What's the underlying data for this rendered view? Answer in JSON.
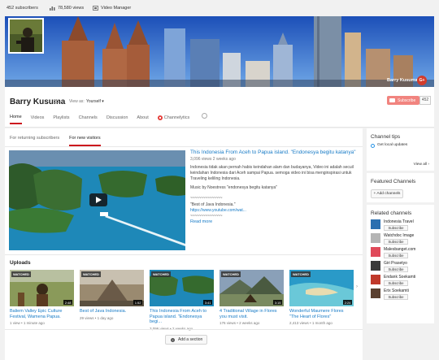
{
  "topbar": {
    "subscribers": "452 subscribers",
    "views": "78,580 views",
    "video_manager": "Video Manager"
  },
  "channel": {
    "name": "Barry Kusuma",
    "banner_name": "Barry Kusuma",
    "view_as_label": "View as:",
    "view_as_value": "Yourself",
    "subscribe_label": "Subscribe",
    "subscriber_count": "452",
    "gplus": "G+"
  },
  "tabs": [
    "Home",
    "Videos",
    "Playlists",
    "Channels",
    "Discussion",
    "About",
    "Channelytics"
  ],
  "subtabs": [
    "For returning subscribers",
    "For new visitors"
  ],
  "featured": {
    "title": "This Indonesia From Aceh to Papua island. \"Endonesya begitu katanya\"",
    "meta": "3,096 views  2 weeks ago",
    "description": "Indonesia tidak akan pernah habis keindahan alam dan budayanya, Video ini adalah secuil keindahan Indonesia dari Aceh sampai Papua. semoga video ini bisa menginspirasi untuk Traveling keliling Indonesia.",
    "music": "Music by Noestress \"endonesya begitu katanya\"",
    "dashes": "~~~~~~~~~~~~~~~",
    "best": "\"Best of Java Indonesia.\"",
    "link": "https://www.youtube.com/wat...",
    "dashes2": "~~~~~~~~~~~~~~~",
    "read_more": "Read more"
  },
  "uploads": {
    "title": "Uploads",
    "watched_label": "WATCHED",
    "items": [
      {
        "title": "Baliem Valley Epic Culture Festival, Wamena Papua.",
        "meta": "1 view  •  1 minute ago",
        "duration": "2:48"
      },
      {
        "title": "Best of Java Indonesia.",
        "meta": "29 views  •  1 day ago",
        "duration": "1:52"
      },
      {
        "title": "This Indonesia From Aceh to Papua island. \"Endonesya begi...",
        "meta": "3,096 views  •  2 weeks ago",
        "duration": "3:41"
      },
      {
        "title": "4 Traditional Village in Flores you must visit.",
        "meta": "176 views  •  2 weeks ago",
        "duration": "3:15"
      },
      {
        "title": "Wonderful Maumere Flores \"The Heart of Flores\"",
        "meta": "2,413 views  •  1 month ago",
        "duration": "2:24"
      }
    ],
    "next": "›"
  },
  "add_section": "Add a section",
  "sidebar": {
    "tips_title": "Channel tips",
    "tip_text": "Get local updates",
    "view_all": "View all ›",
    "featured_title": "Featured Channels",
    "add_channels": "+ Add channels",
    "related_title": "Related channels",
    "subscribe_label": "Subscribe",
    "related": [
      {
        "name": "Indonesia Travel",
        "color": "#2a6fb0"
      },
      {
        "name": "Watchdoc Image",
        "color": "#b5b5b5"
      },
      {
        "name": "Malesbanget.com",
        "color": "#e04a5a"
      },
      {
        "name": "Giri Prasetyo",
        "color": "#3a3a3a"
      },
      {
        "name": "Endank Soekamti",
        "color": "#c0392b"
      },
      {
        "name": "Erix Soekamti",
        "color": "#5a4030"
      }
    ]
  },
  "colors": {
    "accent": "#cc181e",
    "link": "#167ac6",
    "subscribe": "#e62117"
  }
}
